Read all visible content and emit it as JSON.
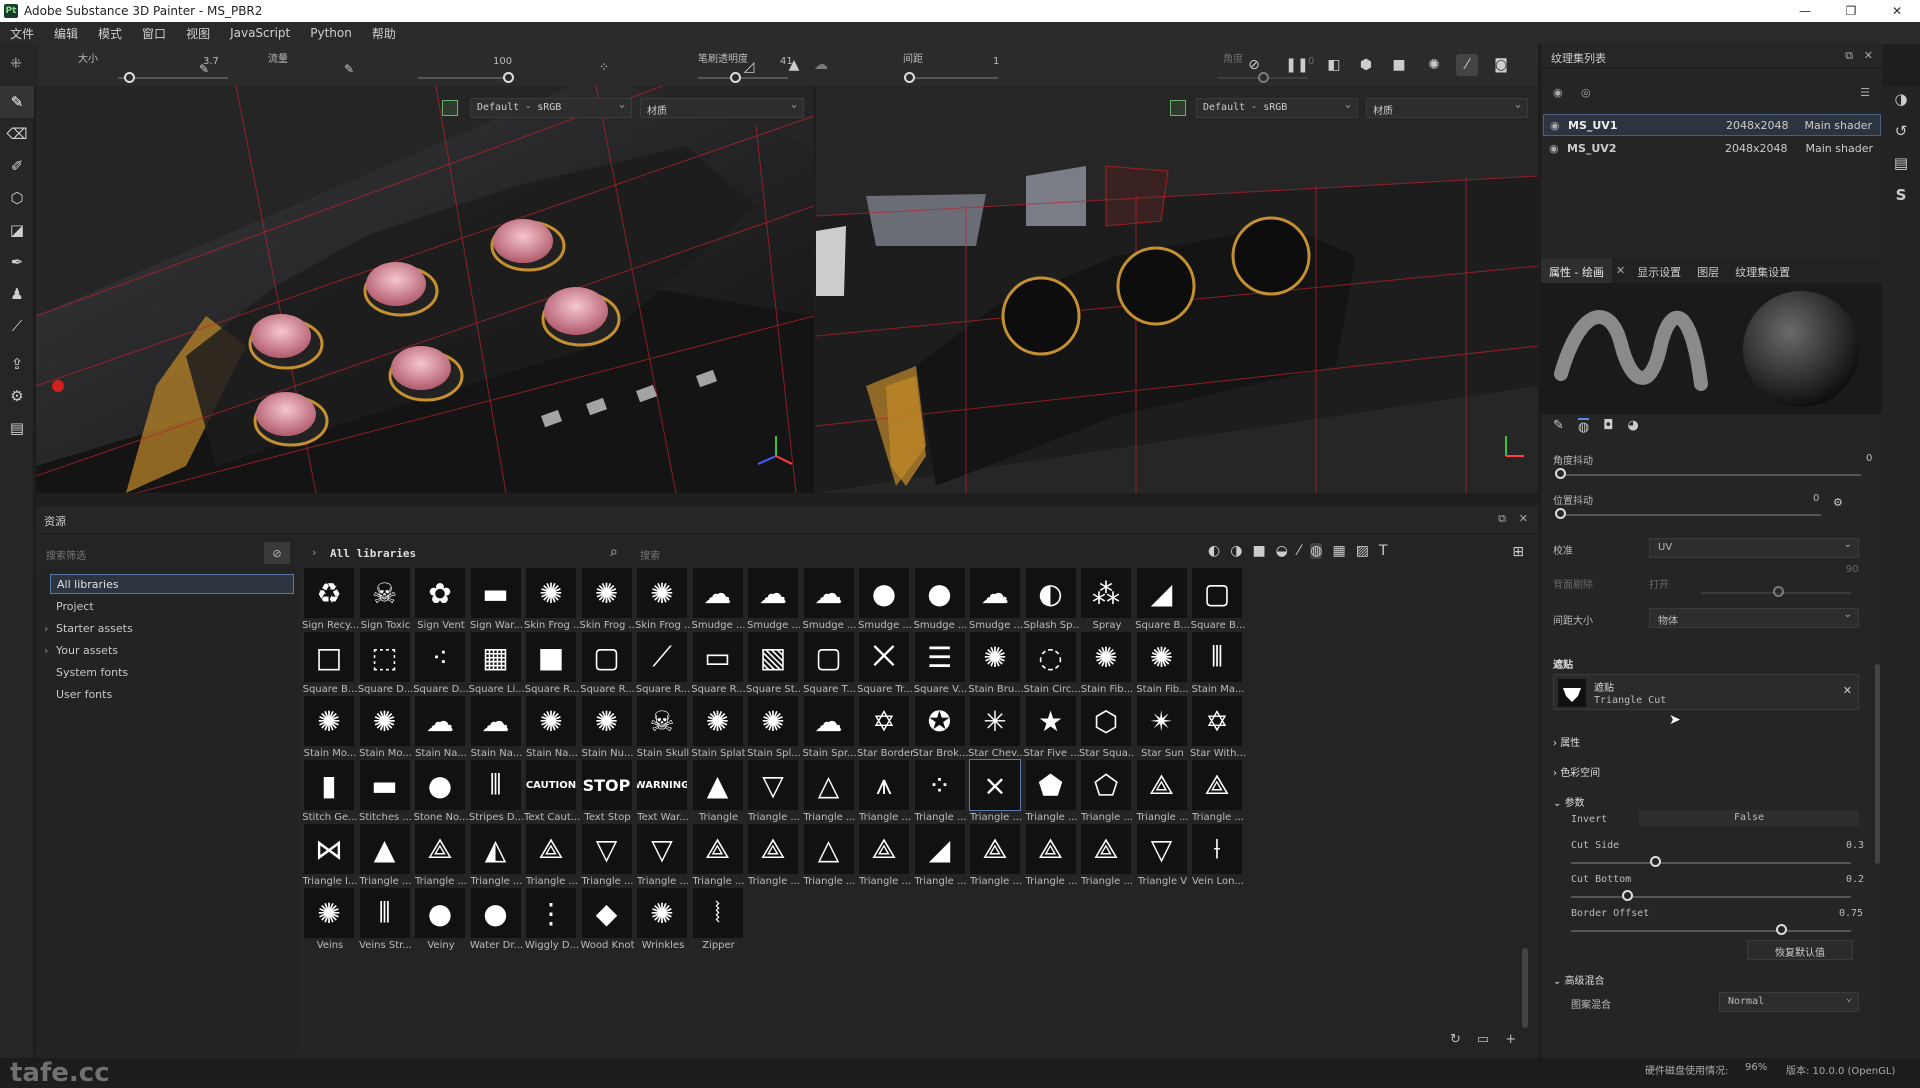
{
  "window": {
    "title": "Adobe Substance 3D Painter - MS_PBR2",
    "app_icon": "Pt"
  },
  "menu": [
    "文件",
    "编辑",
    "模式",
    "窗口",
    "视图",
    "JavaScript",
    "Python",
    "帮助"
  ],
  "toolbar": {
    "size": {
      "label": "大小",
      "value": "3.7",
      "fraction": 0.1
    },
    "flow": {
      "label": "流量",
      "value": "100",
      "fraction": 1.0
    },
    "stroke_opacity": {
      "label": "笔刷透明度",
      "value": "41",
      "fraction": 0.41
    },
    "spacing": {
      "label": "间距",
      "value": "1",
      "fraction": 0.01
    },
    "angle": {
      "label": "角度",
      "value": "0",
      "fraction": 0.5
    }
  },
  "viewport3d": {
    "colorspace": "Default - sRGB",
    "channel": "材质"
  },
  "viewport2d": {
    "colorspace": "Default - sRGB",
    "channel": "材质"
  },
  "texture_sets": {
    "title": "纹理集列表",
    "items": [
      {
        "name": "MS_UV1",
        "size": "2048x2048",
        "shader": "Main shader",
        "selected": true
      },
      {
        "name": "MS_UV2",
        "size": "2048x2048",
        "shader": "Main shader",
        "selected": false
      }
    ]
  },
  "props_tabs": [
    "属性 - 绘画",
    "显示设置",
    "图层",
    "纹理集设置"
  ],
  "props": {
    "angle_jitter": {
      "label": "角度抖动",
      "value": "0"
    },
    "position_jitter": {
      "label": "位置抖动",
      "value": "0"
    },
    "alignment": {
      "label": "校准",
      "value": "UV"
    },
    "backface_cull": {
      "label": "背面剔除",
      "value": "打开",
      "max": "90"
    },
    "spacing_size": {
      "label": "间距大小",
      "value": "物体"
    },
    "alpha_section": "遮贴",
    "alpha_name": "遮贴",
    "alpha_sub": "Triangle Cut",
    "sections": [
      "属性",
      "色彩空间",
      "参数"
    ],
    "invert": {
      "label": "Invert",
      "value": "False"
    },
    "cut_side": {
      "label": "Cut Side",
      "value": "0.3"
    },
    "cut_bottom": {
      "label": "Cut Bottom",
      "value": "0.2"
    },
    "border_offset": {
      "label": "Border Offset",
      "value": "0.75"
    },
    "reset_button": "恢复默认值",
    "advanced": "高级混合",
    "blend": {
      "label": "图案混合",
      "value": "Normal"
    }
  },
  "assets": {
    "title": "资源",
    "filter_placeholder": "搜索筛选",
    "breadcrumb": "All libraries",
    "search_placeholder": "搜索",
    "tree": [
      "All libraries",
      "Project",
      "Starter assets",
      "Your assets",
      "System fonts",
      "User fonts"
    ],
    "rows": [
      [
        "Sign Recy...",
        "Sign Toxic",
        "Sign Vent",
        "Sign War...",
        "Skin Frog ...",
        "Skin Frog ...",
        "Skin Frog ...",
        "Smudge ...",
        "Smudge ...",
        "Smudge ...",
        "Smudge ...",
        "Smudge ...",
        "Smudge ...",
        "Splash Sp...",
        "Spray",
        "Square B...",
        "Square B..."
      ],
      [
        "Square B...",
        "Square D...",
        "Square D...",
        "Square Li...",
        "Square R...",
        "Square R...",
        "Square R...",
        "Square R...",
        "Square St...",
        "Square T...",
        "Square Tr...",
        "Square V...",
        "Stain Bru...",
        "Stain Circ...",
        "Stain Fib...",
        "Stain Fib...",
        "Stain Ma..."
      ],
      [
        "Stain Mo...",
        "Stain Mo...",
        "Stain Na...",
        "Stain Na...",
        "Stain Na...",
        "Stain Nu...",
        "Stain Skull",
        "Stain Splat",
        "Stain Spl...",
        "Stain Spr...",
        "Star Border",
        "Star Brok...",
        "Star Chev...",
        "Star Five ...",
        "Star Squa...",
        "Star Sun",
        "Star With..."
      ],
      [
        "Stitch Ge...",
        "Stitches ...",
        "Stone No...",
        "Stripes D...",
        "Text Caut...",
        "Text Stop",
        "Text War...",
        "Triangle",
        "Triangle ...",
        "Triangle ...",
        "Triangle ...",
        "Triangle ...",
        "Triangle ...",
        "Triangle ...",
        "Triangle ...",
        "Triangle ...",
        "Triangle ..."
      ],
      [
        "Triangle I...",
        "Triangle ...",
        "Triangle ...",
        "Triangle ...",
        "Triangle ...",
        "Triangle ...",
        "Triangle ...",
        "Triangle ...",
        "Triangle ...",
        "Triangle ...",
        "Triangle ...",
        "Triangle ...",
        "Triangle ...",
        "Triangle ...",
        "Triangle ...",
        "Triangle V",
        "Vein Lon..."
      ],
      [
        "Veins",
        "Veins Str...",
        "Veiny",
        "Water Dr...",
        "Wiggly D...",
        "Wood Knot",
        "Wrinkles",
        "Zipper"
      ]
    ],
    "thumb_text": {
      "caution": "CAUTION",
      "stop": "STOP",
      "warning": "WARNING"
    }
  },
  "status": {
    "cache": "硬件磁盘使用情况:",
    "cache_value": "96%",
    "version": "版本: 10.0.0 (OpenGL)"
  },
  "watermark": "tafe.cc"
}
